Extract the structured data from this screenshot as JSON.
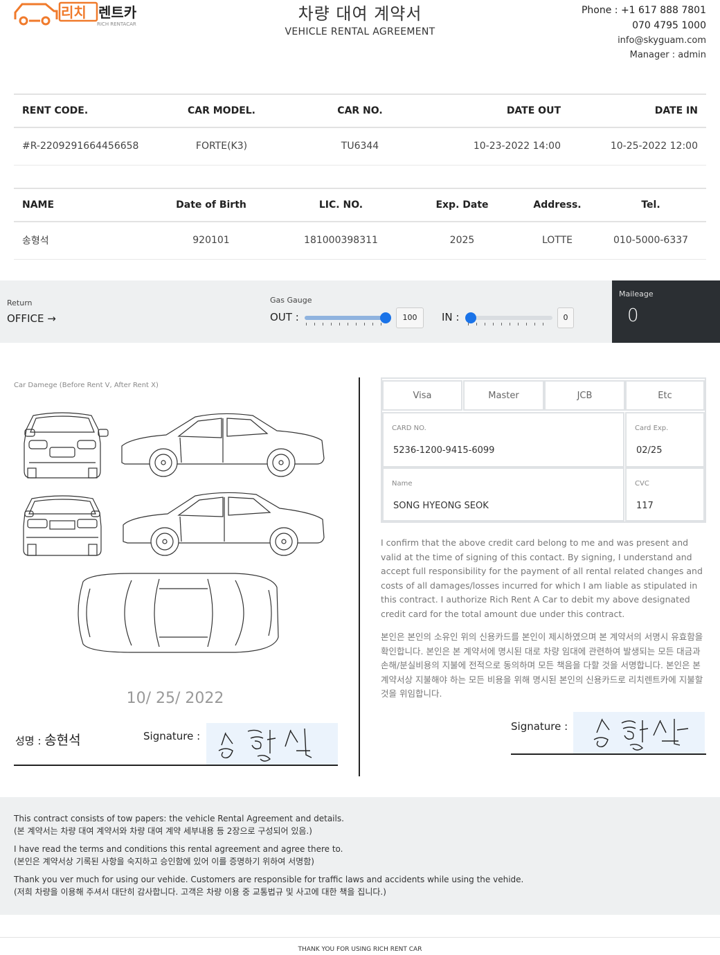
{
  "brand": {
    "name_ko": "리치렌트카",
    "name_en": "RICH RENTACAR",
    "color": "#f07a2b"
  },
  "header": {
    "title_ko": "차량 대여 계약서",
    "title_en": "VEHICLE RENTAL AGREEMENT"
  },
  "contact": {
    "phone": "Phone : +1 617 888 7801",
    "phone2": "070 4795 1000",
    "email": "info@skyguam.com",
    "manager": "Manager : admin"
  },
  "rental": {
    "headers": [
      "RENT CODE.",
      "CAR MODEL.",
      "CAR NO.",
      "DATE OUT",
      "DATE IN"
    ],
    "values": [
      "#R-2209291664456658",
      "FORTE(K3)",
      "TU6344",
      "10-23-2022 14:00",
      "10-25-2022 12:00"
    ]
  },
  "renter": {
    "headers": [
      "NAME",
      "Date of Birth",
      "LIC. NO.",
      "Exp. Date",
      "Address.",
      "Tel."
    ],
    "values": [
      "송형석",
      "920101",
      "181000398311",
      "2025",
      "LOTTE",
      "010-5000-6337"
    ]
  },
  "status": {
    "return_label": "Return",
    "return_value": "OFFICE →",
    "gas_label": "Gas Gauge",
    "out_label": "OUT :",
    "out_value": "100",
    "out_level": 1.0,
    "in_label": "IN :",
    "in_value": "0",
    "in_level": 0.0,
    "mileage_label": "Maileage",
    "mileage_value": "0"
  },
  "damage": {
    "label": "Car Damege (Before Rent V, After Rent X)",
    "date": "10/ 25/ 2022"
  },
  "sign_left": {
    "name_label": "성명 : ",
    "name_value": "송현석",
    "signature_label": "Signature :"
  },
  "payment": {
    "card_types": [
      "Visa",
      "Master",
      "JCB",
      "Etc"
    ],
    "card_no_label": "CARD NO.",
    "card_no": "5236-1200-9415-6099",
    "card_exp_label": "Card Exp.",
    "card_exp": "02/25",
    "name_label": "Name",
    "name": "SONG HYEONG SEOK",
    "cvc_label": "CVC",
    "cvc": "117"
  },
  "legal": {
    "en": "I confirm that the above credit card belong to me and was present and valid at the time of signing of this contact. By signing, I understand and accept full responsibility for the payment of all rental related changes and costs of all damages/losses incurred for which I am liable as stipulated in this contract. I authorize Rich Rent A Car to debit my above designated credit card for the total amount due under this contract.",
    "ko": "본인은 본인의 소유인 위의 신용카드를 본인이 제시하였으며 본 계약서의 서명시 유효함을 확인합니다. 본인은 본 계약서에 명시된 대로 차량 임대에 관련하여 발생되는 모든 대금과 손해/분실비용의 지불에 전적으로 동의하며 모든 책음을 다할 것을 서명합니다. 본인은 본 계약서상 지불해야 하는 모든 비용을 위해 명시된 본인의 신용카드로 리치렌트카에 지불할 것을 위임합니다."
  },
  "sign_right": {
    "signature_label": "Signature :"
  },
  "footer": {
    "lines": [
      "This contract consists of tow papers: the vehicle Rental Agreement and details.",
      "(본 계약서는 차량 대여 계약서와 차량 대여 계약 세부내용 등 2장으로 구성되어 있음.)",
      "I have read the terms and conditions this rental agreement and agree there to.",
      "(본인은 계약서상 기록된 사항을 숙지하고 승인함에 있어 이를 증명하기 위하여 서명함)",
      "Thank you ver much for using our vehide. Customers are responsible for traffic laws and accidents while using the vehide.",
      "(저희 차량을 이용해 주셔서 대단히 감사합니다. 고객은 차량 이용 중 교통법규 및 사고에 대한 책을 집니다.)"
    ],
    "thanks": "THANK YOU FOR USING RICH RENT CAR"
  }
}
